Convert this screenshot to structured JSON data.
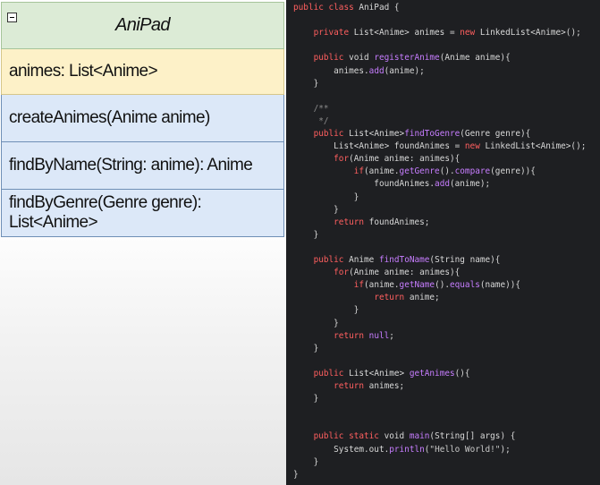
{
  "uml": {
    "class_name": "AniPad",
    "collapse_icon": "minus-box-icon",
    "attributes": [
      "animes: List<Anime>"
    ],
    "methods": [
      "createAnimes(Anime anime)",
      "findByName(String: anime): Anime",
      "findByGenre(Genre genre): List<Anime>"
    ]
  },
  "colors": {
    "title_bg": "#dcebd6",
    "attr_bg": "#fdf1c8",
    "method_bg": "#dce8f8",
    "editor_bg": "#1e1f22",
    "keyword": "#ff5f5f",
    "method_name": "#c77dff"
  },
  "code": {
    "lines": [
      [
        [
          "kw",
          "public class "
        ],
        [
          "p",
          "AniPad {"
        ]
      ],
      [],
      [
        [
          "p",
          "    "
        ],
        [
          "kw",
          "private "
        ],
        [
          "p",
          "List<Anime> animes = "
        ],
        [
          "kw",
          "new "
        ],
        [
          "p",
          "LinkedList<Anime>();"
        ]
      ],
      [],
      [
        [
          "p",
          "    "
        ],
        [
          "kw",
          "public "
        ],
        [
          "p",
          "void "
        ],
        [
          "fn",
          "registerAnime"
        ],
        [
          "p",
          "(Anime anime){"
        ]
      ],
      [
        [
          "p",
          "        animes."
        ],
        [
          "fn",
          "add"
        ],
        [
          "p",
          "(anime);"
        ]
      ],
      [
        [
          "p",
          "    }"
        ]
      ],
      [],
      [
        [
          "cm",
          "    /**"
        ]
      ],
      [
        [
          "cm",
          "     */"
        ]
      ],
      [
        [
          "p",
          "    "
        ],
        [
          "kw",
          "public "
        ],
        [
          "p",
          "List<Anime>"
        ],
        [
          "fn",
          "findToGenre"
        ],
        [
          "p",
          "(Genre genre){"
        ]
      ],
      [
        [
          "p",
          "        List<Anime> foundAnimes = "
        ],
        [
          "kw",
          "new "
        ],
        [
          "p",
          "LinkedList<Anime>();"
        ]
      ],
      [
        [
          "p",
          "        "
        ],
        [
          "kw",
          "for"
        ],
        [
          "p",
          "(Anime anime: animes){"
        ]
      ],
      [
        [
          "p",
          "            "
        ],
        [
          "kw",
          "if"
        ],
        [
          "p",
          "(anime."
        ],
        [
          "fn",
          "getGenre"
        ],
        [
          "p",
          "()."
        ],
        [
          "fn",
          "compare"
        ],
        [
          "p",
          "(genre)){"
        ]
      ],
      [
        [
          "p",
          "                foundAnimes."
        ],
        [
          "fn",
          "add"
        ],
        [
          "p",
          "(anime);"
        ]
      ],
      [
        [
          "p",
          "            }"
        ]
      ],
      [
        [
          "p",
          "        }"
        ]
      ],
      [
        [
          "p",
          "        "
        ],
        [
          "kw",
          "return "
        ],
        [
          "p",
          "foundAnimes;"
        ]
      ],
      [
        [
          "p",
          "    }"
        ]
      ],
      [],
      [
        [
          "p",
          "    "
        ],
        [
          "kw",
          "public "
        ],
        [
          "p",
          "Anime "
        ],
        [
          "fn",
          "findToName"
        ],
        [
          "p",
          "(String name){"
        ]
      ],
      [
        [
          "p",
          "        "
        ],
        [
          "kw",
          "for"
        ],
        [
          "p",
          "(Anime anime: animes){"
        ]
      ],
      [
        [
          "p",
          "            "
        ],
        [
          "kw",
          "if"
        ],
        [
          "p",
          "(anime."
        ],
        [
          "fn",
          "getName"
        ],
        [
          "p",
          "()."
        ],
        [
          "fn",
          "equals"
        ],
        [
          "p",
          "(name)){"
        ]
      ],
      [
        [
          "p",
          "                "
        ],
        [
          "kw",
          "return "
        ],
        [
          "p",
          "anime;"
        ]
      ],
      [
        [
          "p",
          "            }"
        ]
      ],
      [
        [
          "p",
          "        }"
        ]
      ],
      [
        [
          "p",
          "        "
        ],
        [
          "kw",
          "return "
        ],
        [
          "fn",
          "null"
        ],
        [
          "p",
          ";"
        ]
      ],
      [
        [
          "p",
          "    }"
        ]
      ],
      [],
      [
        [
          "p",
          "    "
        ],
        [
          "kw",
          "public "
        ],
        [
          "p",
          "List<Anime> "
        ],
        [
          "fn",
          "getAnimes"
        ],
        [
          "p",
          "(){"
        ]
      ],
      [
        [
          "p",
          "        "
        ],
        [
          "kw",
          "return "
        ],
        [
          "p",
          "animes;"
        ]
      ],
      [
        [
          "p",
          "    }"
        ]
      ],
      [],
      [],
      [
        [
          "p",
          "    "
        ],
        [
          "kw",
          "public static "
        ],
        [
          "p",
          "void "
        ],
        [
          "fn",
          "main"
        ],
        [
          "p",
          "(String[] args) {"
        ]
      ],
      [
        [
          "p",
          "        System.out."
        ],
        [
          "fn",
          "println"
        ],
        [
          "p",
          "("
        ],
        [
          "str",
          "\"Hello World!\""
        ],
        [
          "p",
          ");"
        ]
      ],
      [
        [
          "p",
          "    }"
        ]
      ],
      [
        [
          "p",
          "}"
        ]
      ]
    ]
  }
}
